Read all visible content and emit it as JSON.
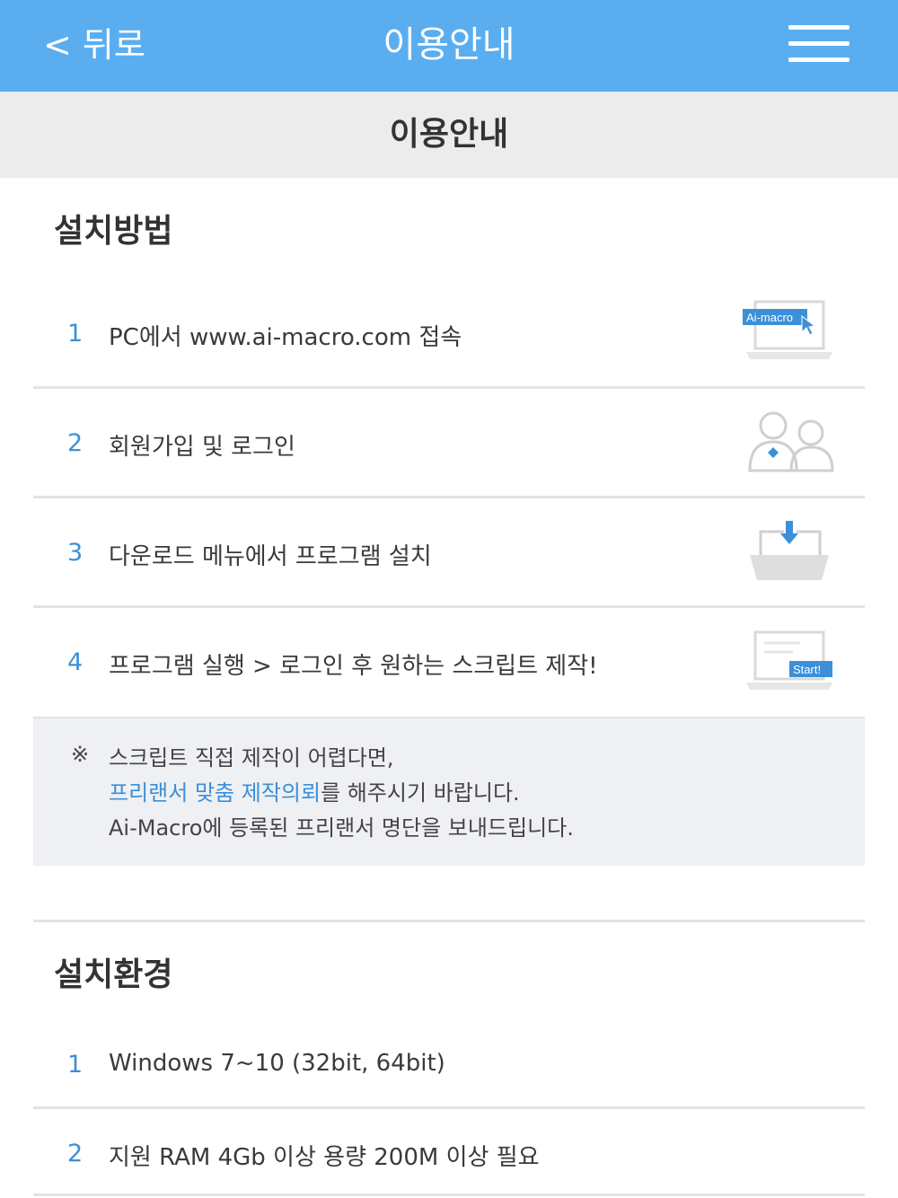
{
  "header": {
    "back_label": "< 뒤로",
    "title": "이용안내",
    "menu_icon": "hamburger-menu-icon"
  },
  "subheader": {
    "title": "이용안내"
  },
  "install_method": {
    "title": "설치방법",
    "steps": [
      {
        "num": "1",
        "text": "PC에서 www.ai-macro.com 접속",
        "icon": "laptop-ai-macro-icon",
        "icon_label": "Ai-macro"
      },
      {
        "num": "2",
        "text": "회원가입 및 로그인",
        "icon": "users-icon"
      },
      {
        "num": "3",
        "text": "다운로드 메뉴에서 프로그램 설치",
        "icon": "download-tray-icon"
      },
      {
        "num": "4",
        "text": "프로그램 실행 > 로그인 후 원하는 스크립트 제작!",
        "icon": "laptop-start-icon",
        "icon_label": "Start!"
      }
    ]
  },
  "notice": {
    "mark": "※",
    "line1": "스크립트 직접 제작이 어렵다면,",
    "line2_link": "프리랜서 맞춤 제작의뢰",
    "line2_rest": "를 해주시기 바랍니다.",
    "line3": "Ai-Macro에 등록된 프리랜서 명단을 보내드립니다."
  },
  "install_env": {
    "title": "설치환경",
    "items": [
      {
        "num": "1",
        "text": "Windows 7~10 (32bit, 64bit)"
      },
      {
        "num": "2",
        "text": "지원 RAM 4Gb 이상 용량 200M 이상 필요"
      }
    ]
  },
  "colors": {
    "header_bg": "#5aaef0",
    "accent": "#3c8fd8",
    "subheader_bg": "#ececec",
    "notice_bg": "#eef0f3"
  }
}
